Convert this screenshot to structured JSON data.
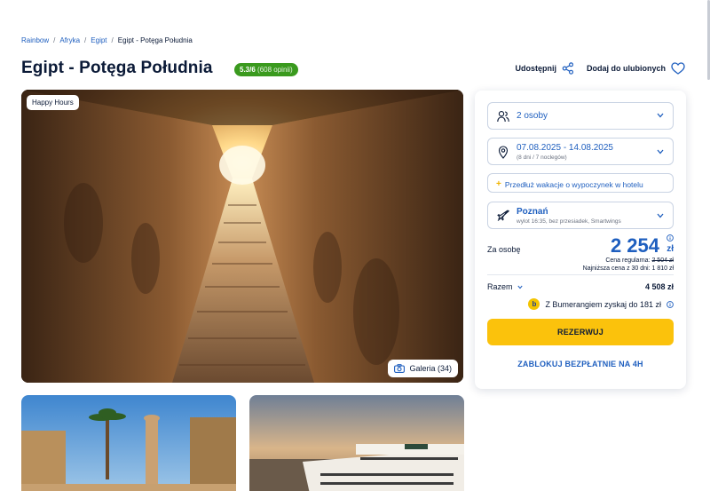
{
  "breadcrumb": {
    "items": [
      "Rainbow",
      "Afryka",
      "Egipt"
    ],
    "separator": "/",
    "current": "Egipt - Potęga Południa"
  },
  "page": {
    "title": "Egipt - Potęga Południa",
    "rating_score": "5.3/6",
    "rating_count": "(608 opinii)",
    "share_label": "Udostępnij",
    "favorite_label": "Dodaj do ulubionych"
  },
  "hero": {
    "badge": "Happy Hours",
    "gallery_label": "Galeria (34)"
  },
  "booking": {
    "persons": "2 osoby",
    "dates": "07.08.2025 - 14.08.2025",
    "dates_sub": "(8 dni / 7 noclegów)",
    "extend": "Przedłuż wakacje o wypoczynek w hotelu",
    "airport": "Poznań",
    "flight_sub": "wylot 16:35, bez przesiadek, Smartwings",
    "per_person_label": "Za osobę",
    "price": "2 254",
    "currency": "zł",
    "regular_label": "Cena regularna:",
    "regular_price": "2 504 zł",
    "lowest_label": "Najniższa cena z 30 dni: 1 810 zł",
    "total_label": "Razem",
    "total_value": "4 508 zł",
    "bumerang_text": "Z Bumerangiem zyskaj do 181 zł",
    "bumerang_logo": "b",
    "reserve_label": "REZERWUJ",
    "lock_label": "ZABLOKUJ BEZPŁATNIE NA 4H"
  },
  "colors": {
    "accent_blue": "#1f5fbf",
    "cta_yellow": "#fbc20c",
    "rating_green": "#3a9a1e",
    "text_dark": "#0b1a37"
  }
}
